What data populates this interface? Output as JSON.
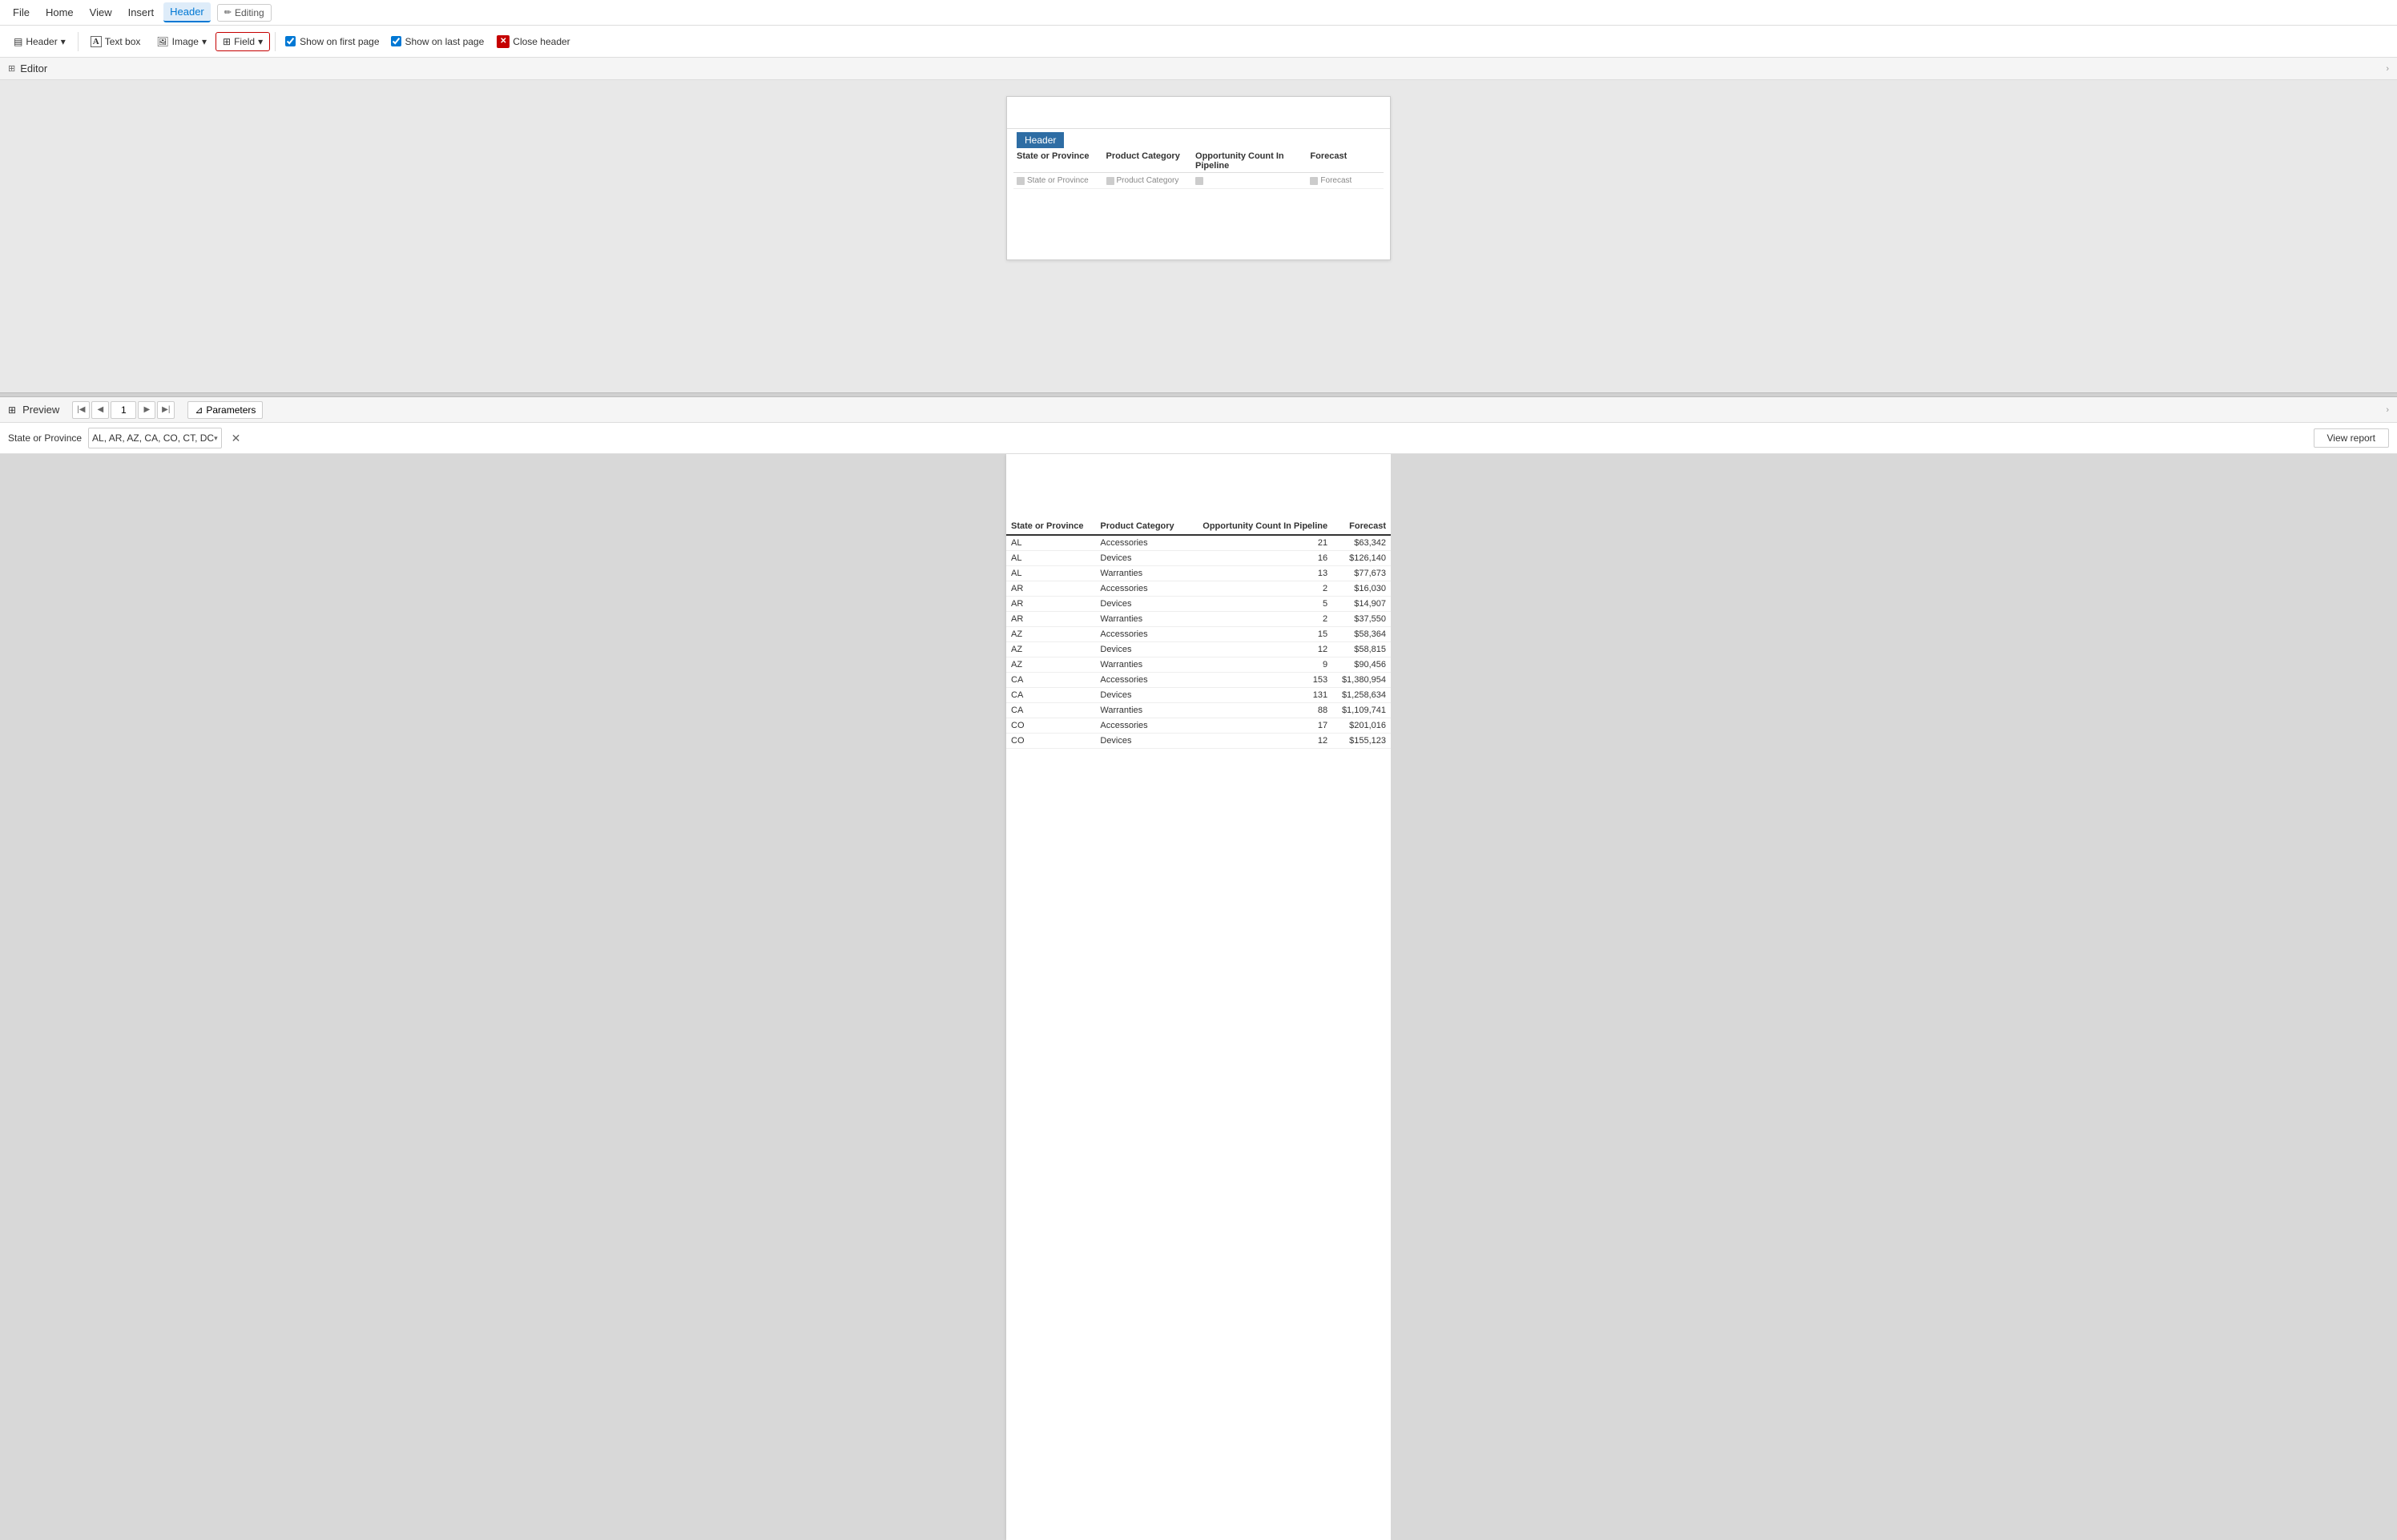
{
  "menubar": {
    "items": [
      {
        "id": "file",
        "label": "File"
      },
      {
        "id": "home",
        "label": "Home"
      },
      {
        "id": "view",
        "label": "View"
      },
      {
        "id": "insert",
        "label": "Insert"
      },
      {
        "id": "header",
        "label": "Header",
        "active": true
      }
    ],
    "editing_badge": "Editing"
  },
  "toolbar": {
    "header_btn": "Header",
    "textbox_btn": "Text box",
    "image_btn": "Image",
    "field_btn": "Field",
    "show_on_first": "Show on first page",
    "show_on_last": "Show on last page",
    "close_header": "Close header",
    "chevron": "▾"
  },
  "editor_section": {
    "label": "Editor"
  },
  "canvas": {
    "header_tab": "Header",
    "columns": [
      {
        "label": "State or Province"
      },
      {
        "label": "Product Category"
      },
      {
        "label": "Opportunity Count In Pipeline"
      },
      {
        "label": "Forecast"
      }
    ],
    "data_row": [
      {
        "label": "State or Province"
      },
      {
        "label": "Product Category"
      },
      {
        "label": ""
      },
      {
        "label": "Forecast"
      }
    ]
  },
  "preview_section": {
    "label": "Preview",
    "page": "1",
    "params_btn": "Parameters"
  },
  "params_bar": {
    "label": "State or Province",
    "value": "AL, AR, AZ, CA, CO, CT, DC",
    "view_report": "View report"
  },
  "preview_table": {
    "columns": [
      {
        "label": "State or Province"
      },
      {
        "label": "Product Category"
      },
      {
        "label": "Opportunity Count In Pipeline",
        "align": "right"
      },
      {
        "label": "Forecast",
        "align": "right"
      }
    ],
    "rows": [
      {
        "state": "AL",
        "category": "Accessories",
        "count": "21",
        "forecast": "$63,342"
      },
      {
        "state": "AL",
        "category": "Devices",
        "count": "16",
        "forecast": "$126,140"
      },
      {
        "state": "AL",
        "category": "Warranties",
        "count": "13",
        "forecast": "$77,673"
      },
      {
        "state": "AR",
        "category": "Accessories",
        "count": "2",
        "forecast": "$16,030"
      },
      {
        "state": "AR",
        "category": "Devices",
        "count": "5",
        "forecast": "$14,907"
      },
      {
        "state": "AR",
        "category": "Warranties",
        "count": "2",
        "forecast": "$37,550"
      },
      {
        "state": "AZ",
        "category": "Accessories",
        "count": "15",
        "forecast": "$58,364"
      },
      {
        "state": "AZ",
        "category": "Devices",
        "count": "12",
        "forecast": "$58,815"
      },
      {
        "state": "AZ",
        "category": "Warranties",
        "count": "9",
        "forecast": "$90,456"
      },
      {
        "state": "CA",
        "category": "Accessories",
        "count": "153",
        "forecast": "$1,380,954"
      },
      {
        "state": "CA",
        "category": "Devices",
        "count": "131",
        "forecast": "$1,258,634"
      },
      {
        "state": "CA",
        "category": "Warranties",
        "count": "88",
        "forecast": "$1,109,741"
      },
      {
        "state": "CO",
        "category": "Accessories",
        "count": "17",
        "forecast": "$201,016"
      },
      {
        "state": "CO",
        "category": "Devices",
        "count": "12",
        "forecast": "$155,123"
      }
    ]
  }
}
